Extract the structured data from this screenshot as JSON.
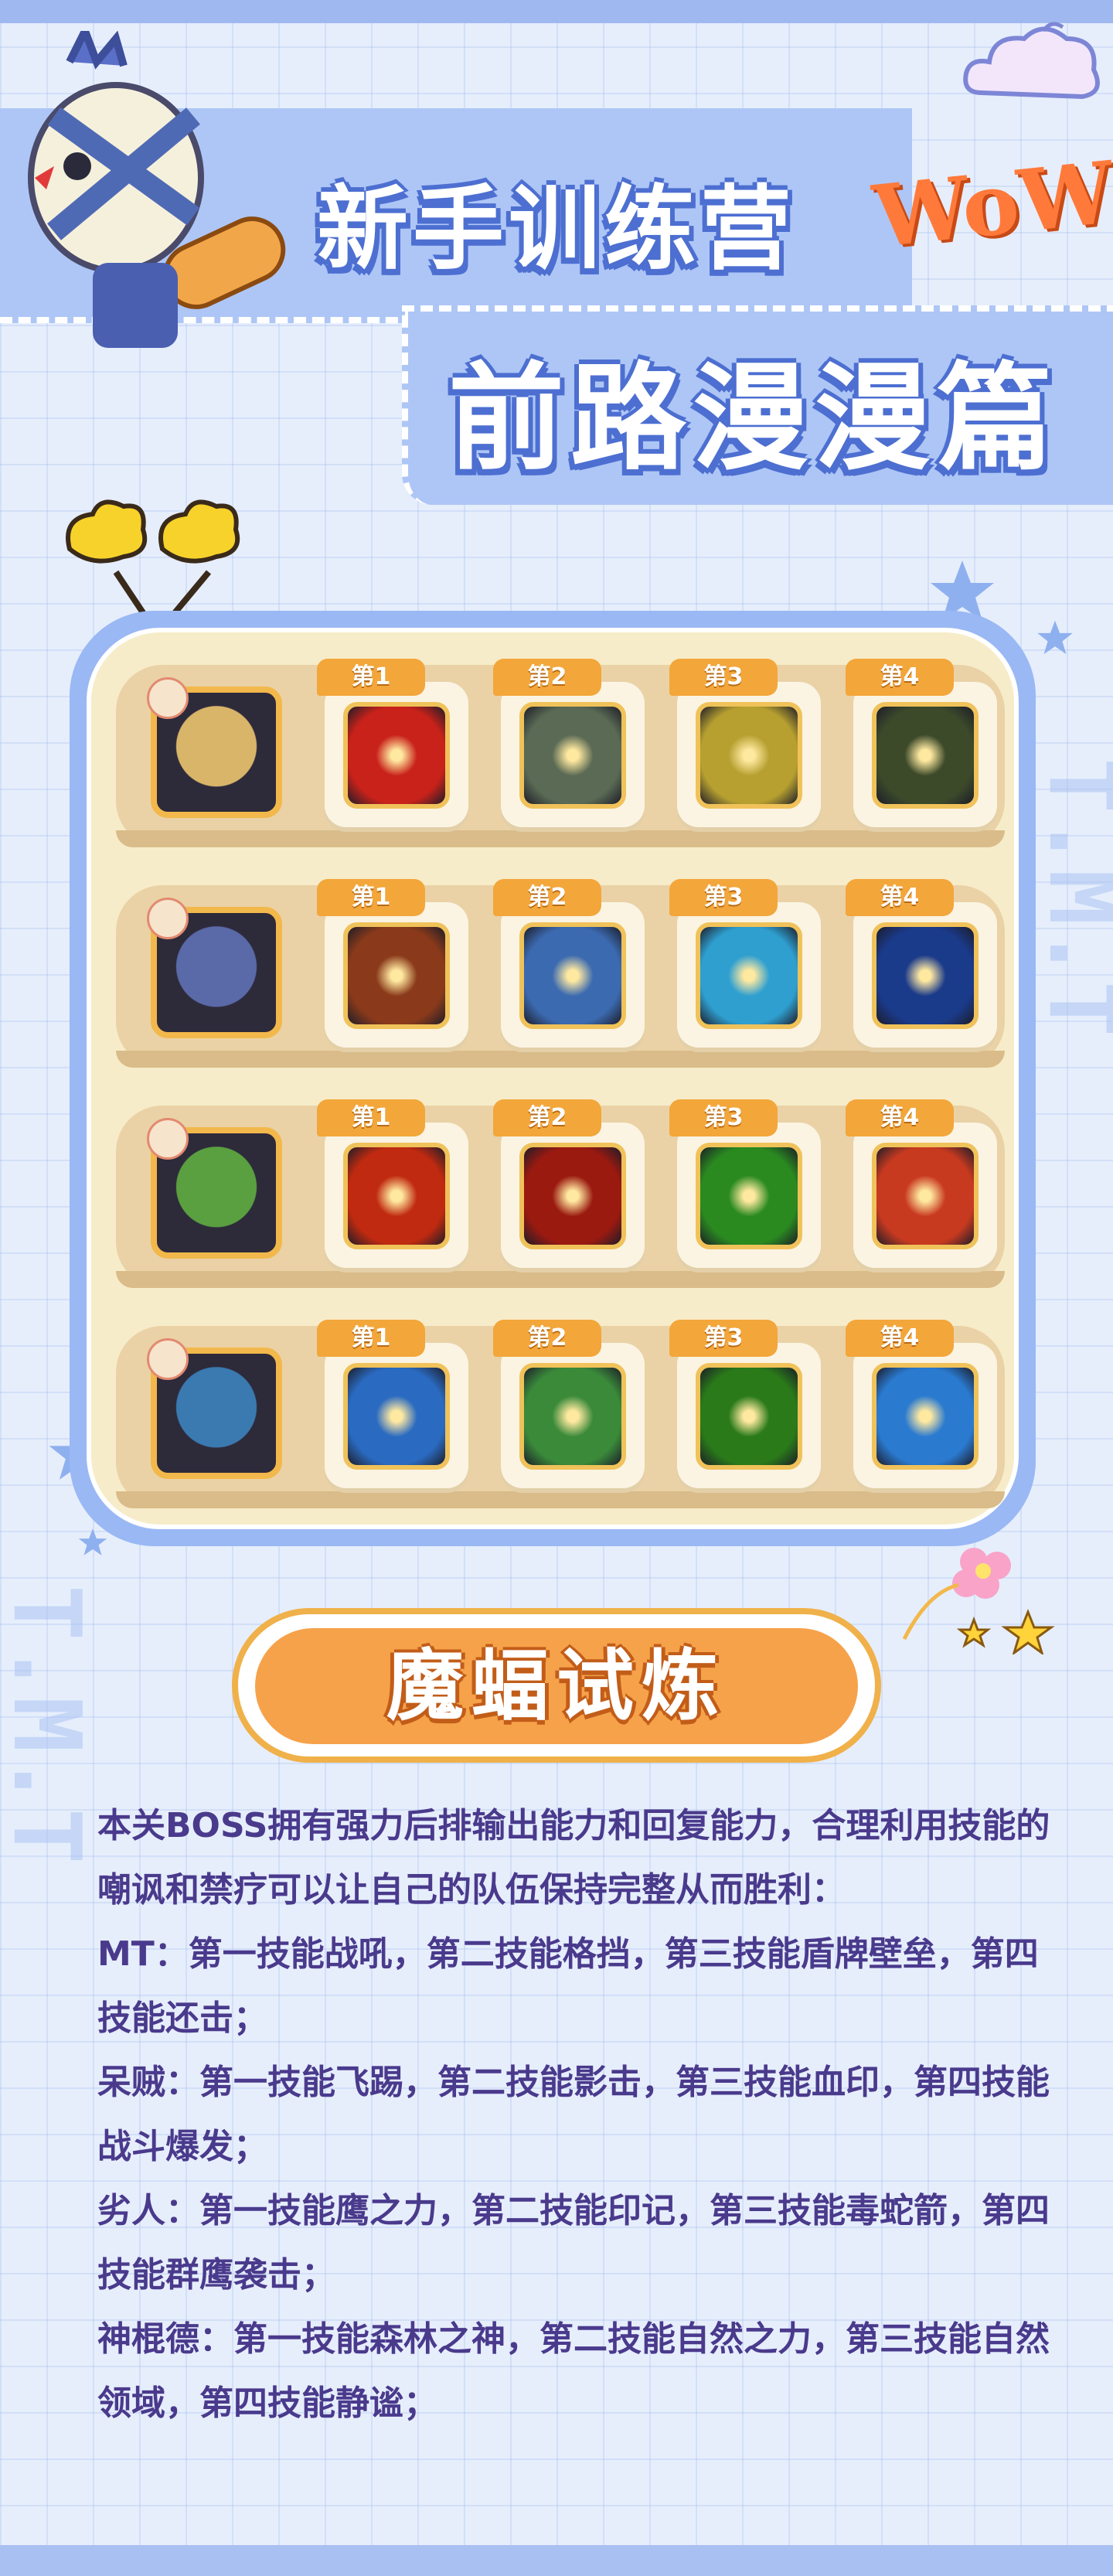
{
  "header": {
    "title_line1": "新手训练营",
    "title_line2": "前路漫漫篇",
    "wow": "WoW"
  },
  "decor": {
    "watermark": "T.M.T"
  },
  "colors": {
    "title_outline": "#4d6fd1",
    "panel_border": "#9ab8f4",
    "tag_orange": "#f3a63a",
    "pill_orange": "#f6a24a",
    "text_purple": "#4a3a8c"
  },
  "roster": {
    "rows": [
      {
        "boss_icon": "tauren-portrait",
        "skills": [
          {
            "tag": "第1",
            "icon": "battle-shout-icon",
            "color": "#c8221a"
          },
          {
            "tag": "第2",
            "icon": "block-icon",
            "color": "#5a6a54"
          },
          {
            "tag": "第3",
            "icon": "shield-wall-icon",
            "color": "#b7a030"
          },
          {
            "tag": "第4",
            "icon": "revenge-icon",
            "color": "#3c4a2a"
          }
        ]
      },
      {
        "boss_icon": "treant-portrait",
        "skills": [
          {
            "tag": "第1",
            "icon": "fly-kick-icon",
            "color": "#8a3a1a"
          },
          {
            "tag": "第2",
            "icon": "shadow-strike-icon",
            "color": "#3b6ab0"
          },
          {
            "tag": "第3",
            "icon": "blood-mark-icon",
            "color": "#2f9fd0"
          },
          {
            "tag": "第4",
            "icon": "battle-burst-icon",
            "color": "#1a3a8a"
          }
        ]
      },
      {
        "boss_icon": "orc-portrait",
        "skills": [
          {
            "tag": "第1",
            "icon": "eagle-power-icon",
            "color": "#c02a10"
          },
          {
            "tag": "第2",
            "icon": "mark-icon",
            "color": "#9a1a10"
          },
          {
            "tag": "第3",
            "icon": "serpent-arrow-icon",
            "color": "#2a8a20"
          },
          {
            "tag": "第4",
            "icon": "eagle-swarm-icon",
            "color": "#c83a20"
          }
        ]
      },
      {
        "boss_icon": "fish-portrait",
        "skills": [
          {
            "tag": "第1",
            "icon": "forest-god-icon",
            "color": "#2a6ac0"
          },
          {
            "tag": "第2",
            "icon": "nature-power-icon",
            "color": "#3a8a3a"
          },
          {
            "tag": "第3",
            "icon": "nature-domain-icon",
            "color": "#2a7a1a"
          },
          {
            "tag": "第4",
            "icon": "silence-icon",
            "color": "#2a7ad0"
          }
        ]
      }
    ]
  },
  "section_title": "魔蝠试炼",
  "description": [
    "本关BOSS拥有强力后排输出能力和回复能力，合理利用技能的嘲讽和禁疗可以让自己的队伍保持完整从而胜利：",
    "MT：第一技能战吼，第二技能格挡，第三技能盾牌壁垒，第四技能还击；",
    "呆贼：第一技能飞踢，第二技能影击，第三技能血印，第四技能战斗爆发；",
    "劣人：第一技能鹰之力，第二技能印记，第三技能毒蛇箭，第四技能群鹰袭击；",
    "神棍德：第一技能森林之神，第二技能自然之力，第三技能自然领域，第四技能静谧；"
  ]
}
